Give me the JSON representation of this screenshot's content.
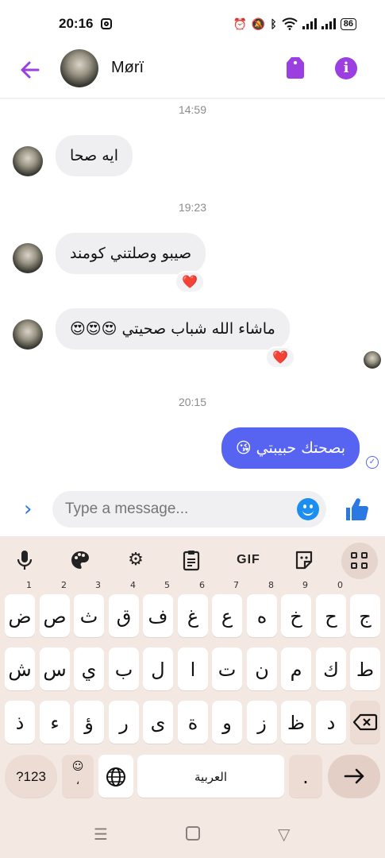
{
  "status_bar": {
    "time": "20:16",
    "battery": "86"
  },
  "header": {
    "contact_name": "Mørï",
    "accent_color": "#9b3fe0"
  },
  "messages": [
    {
      "type": "timestamp",
      "text": "14:59"
    },
    {
      "type": "incoming",
      "text": "ايه صحا"
    },
    {
      "type": "timestamp",
      "text": "19:23"
    },
    {
      "type": "incoming",
      "text": "صيبو وصلتني كومند",
      "reaction": "❤️"
    },
    {
      "type": "incoming",
      "text": "ماشاء الله شباب صحيتي 😍😍😍",
      "reaction": "❤️"
    },
    {
      "type": "timestamp",
      "text": "20:15"
    },
    {
      "type": "outgoing",
      "text": "بصحتك حبيبتي 😘"
    }
  ],
  "composer": {
    "placeholder": "Type a message..."
  },
  "keyboard": {
    "toolbar": [
      "mic-icon",
      "palette-icon",
      "gear-icon",
      "clipboard-icon",
      "GIF",
      "sticker-icon",
      "apps-grid-icon"
    ],
    "gif_label": "GIF",
    "row1": [
      {
        "k": "ض",
        "h": "1"
      },
      {
        "k": "ص",
        "h": "2"
      },
      {
        "k": "ث",
        "h": "3"
      },
      {
        "k": "ق",
        "h": "4"
      },
      {
        "k": "ف",
        "h": "5"
      },
      {
        "k": "غ",
        "h": "6"
      },
      {
        "k": "ع",
        "h": "7"
      },
      {
        "k": "ه",
        "h": "8"
      },
      {
        "k": "خ",
        "h": "9"
      },
      {
        "k": "ح",
        "h": "0"
      },
      {
        "k": "ج",
        "h": ""
      }
    ],
    "row2": [
      "ش",
      "س",
      "ي",
      "ب",
      "ل",
      "ا",
      "ت",
      "ن",
      "م",
      "ك",
      "ط"
    ],
    "row3": [
      "ذ",
      "ء",
      "ؤ",
      "ر",
      "ى",
      "ة",
      "و",
      "ز",
      "ظ",
      "د"
    ],
    "symbols_key": "?123",
    "comma_key": "،",
    "space_label": "العربية",
    "period_key": ".",
    "bg_color": "#f4e8e3"
  }
}
